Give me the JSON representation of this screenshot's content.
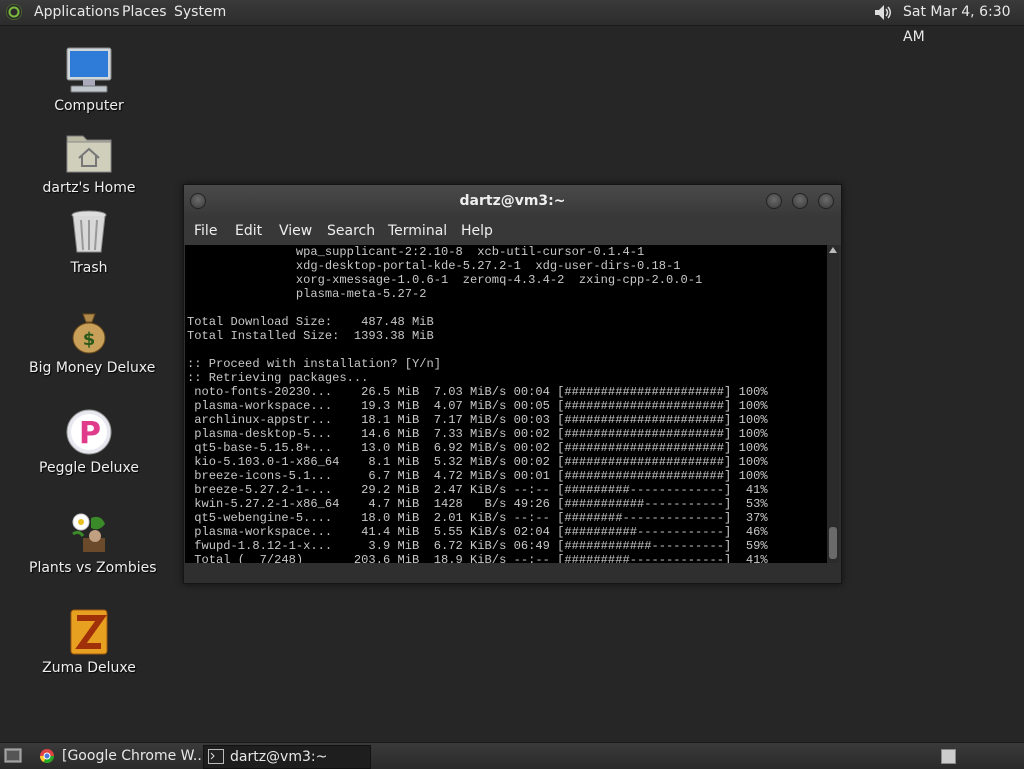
{
  "top_panel": {
    "menus": [
      "Applications",
      "Places",
      "System"
    ],
    "clock": "Sat Mar  4,  6:30 AM"
  },
  "desktop_icons": [
    {
      "label": "Computer",
      "icon": "computer-icon"
    },
    {
      "label": "dartz's Home",
      "icon": "home-folder-icon"
    },
    {
      "label": "Trash",
      "icon": "trash-icon"
    },
    {
      "label": "Big Money Deluxe",
      "icon": "money-bag-icon"
    },
    {
      "label": "Peggle Deluxe",
      "icon": "peggle-icon"
    },
    {
      "label": "Plants vs Zombies",
      "icon": "plants-vs-zombies-icon"
    },
    {
      "label": "Zuma Deluxe",
      "icon": "zuma-icon"
    }
  ],
  "terminal": {
    "title": "dartz@vm3:~",
    "menu": [
      "File",
      "Edit",
      "View",
      "Search",
      "Terminal",
      "Help"
    ],
    "lines": [
      "               wpa_supplicant-2:2.10-8  xcb-util-cursor-0.1.4-1",
      "               xdg-desktop-portal-kde-5.27.2-1  xdg-user-dirs-0.18-1",
      "               xorg-xmessage-1.0.6-1  zeromq-4.3.4-2  zxing-cpp-2.0.0-1",
      "               plasma-meta-5.27-2",
      "",
      "Total Download Size:    487.48 MiB",
      "Total Installed Size:  1393.38 MiB",
      "",
      ":: Proceed with installation? [Y/n]",
      ":: Retrieving packages...",
      " noto-fonts-20230...    26.5 MiB  7.03 MiB/s 00:04 [######################] 100%",
      " plasma-workspace...    19.3 MiB  4.07 MiB/s 00:05 [######################] 100%",
      " archlinux-appstr...    18.1 MiB  7.17 MiB/s 00:03 [######################] 100%",
      " plasma-desktop-5...    14.6 MiB  7.33 MiB/s 00:02 [######################] 100%",
      " qt5-base-5.15.8+...    13.0 MiB  6.92 MiB/s 00:02 [######################] 100%",
      " kio-5.103.0-1-x86_64    8.1 MiB  5.32 MiB/s 00:02 [######################] 100%",
      " breeze-icons-5.1...     6.7 MiB  4.72 MiB/s 00:01 [######################] 100%",
      " breeze-5.27.2-1-...    29.2 MiB  2.47 KiB/s --:-- [#########-------------]  41%",
      " kwin-5.27.2-1-x86_64    4.7 MiB  1428   B/s 49:26 [###########-----------]  53%",
      " qt5-webengine-5....    18.0 MiB  2.01 KiB/s --:-- [########--------------]  37%",
      " plasma-workspace...    41.4 MiB  5.55 KiB/s 02:04 [##########------------]  46%",
      " fwupd-1.8.12-1-x...     3.9 MiB  6.72 KiB/s 06:49 [############----------]  59%",
      " Total (  7/248)       203.6 MiB  18.9 KiB/s --:-- [#########-------------]  41%"
    ]
  },
  "taskbar": {
    "tasks": [
      {
        "label": "[Google Chrome W...",
        "active": false
      },
      {
        "label": "dartz@vm3:~",
        "active": true
      }
    ]
  }
}
